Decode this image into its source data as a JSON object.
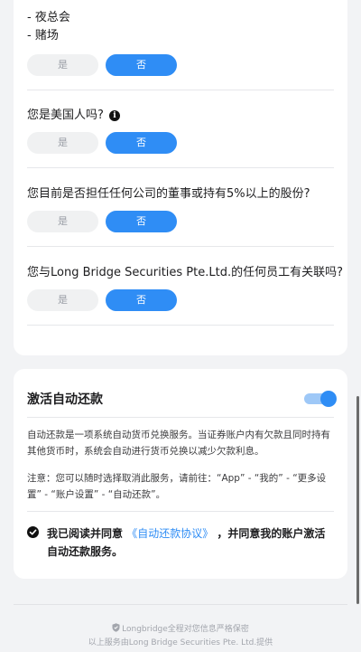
{
  "top_card": {
    "bullets": [
      "- 夜总会",
      "- 赌场"
    ],
    "questions": [
      {
        "text": "",
        "yes": "是",
        "no": "否"
      },
      {
        "text": "您是美国人吗?",
        "yes": "是",
        "no": "否"
      },
      {
        "text": "您目前是否担任任何公司的董事或持有5%以上的股份?",
        "yes": "是",
        "no": "否"
      },
      {
        "text": "您与Long Bridge Securities Pte.Ltd.的任何员工有关联吗?",
        "yes": "是",
        "no": "否"
      }
    ],
    "info_icon": "info-icon"
  },
  "auto_repay": {
    "title": "激活自动还款",
    "toggle_on": true,
    "accent_color": "#2f8df5",
    "desc": "自动还款是一项系统自动货币兑换服务。当证券账户内有欠款且同时持有其他货币时，系统会自动进行货币兑换以减少欠款利息。",
    "note": "注意：您可以随时选择取消此服务，请前往：“App” - “我的” - “更多设置” - “账户设置” - “自动还款”。",
    "agree_prefix": "我已阅读并同意 ",
    "agree_link": "《自动还款协议》",
    "agree_suffix": " ，并同意我的账户激活自动还款服务。"
  },
  "footer": {
    "line1": "Longbridge全程对您信息严格保密",
    "line2": "以上服务由Long Bridge Securities Pte. Ltd.提供"
  }
}
